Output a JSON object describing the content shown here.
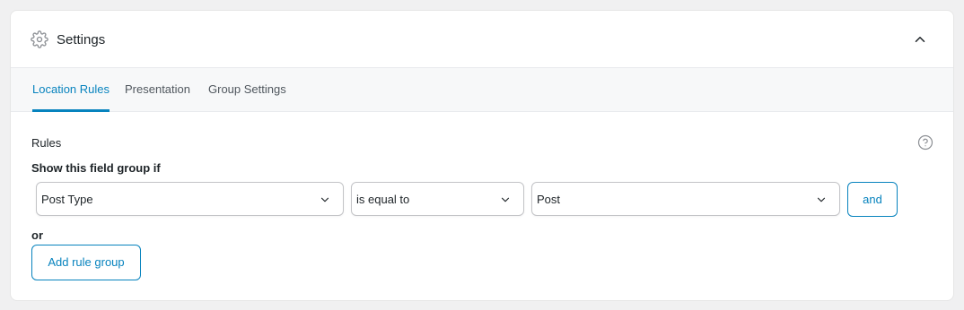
{
  "header": {
    "title": "Settings",
    "icon": "gear-icon",
    "collapse_icon": "chevron-up-icon"
  },
  "tabs": [
    {
      "label": "Location Rules",
      "active": true
    },
    {
      "label": "Presentation",
      "active": false
    },
    {
      "label": "Group Settings",
      "active": false
    }
  ],
  "rules": {
    "label": "Rules",
    "help_icon": "help-circle-icon",
    "show_if_label": "Show this field group if",
    "rule": {
      "param": "Post Type",
      "operator": "is equal to",
      "value": "Post",
      "and_label": "and"
    },
    "or_label": "or",
    "add_group_label": "Add rule group"
  },
  "colors": {
    "accent": "#0783be",
    "background": "#f0f0f1",
    "tab_bar": "#f7f8f9"
  }
}
